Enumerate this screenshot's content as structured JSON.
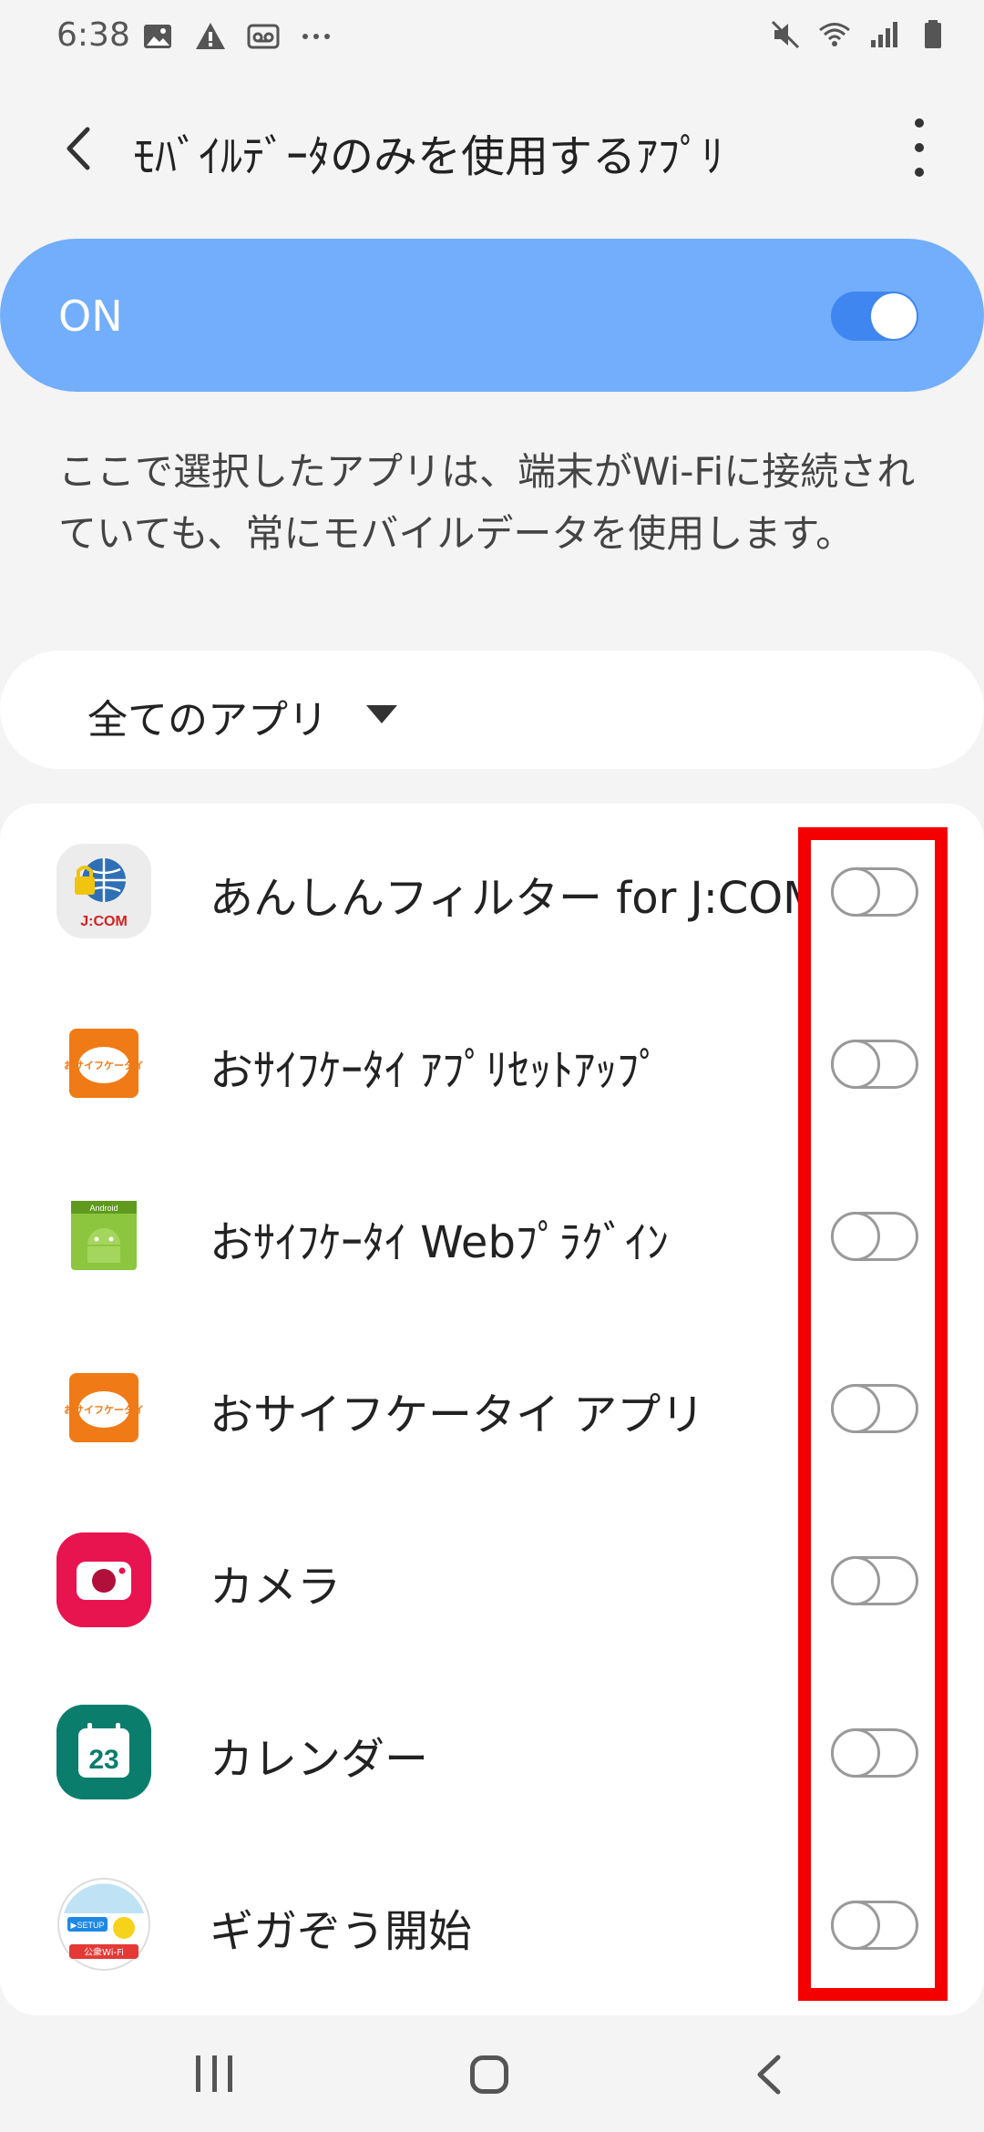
{
  "status_bar": {
    "time": "6:38",
    "left_icons": [
      "image-icon",
      "warning-icon",
      "voicemail-icon",
      "more-dots-icon"
    ],
    "right_icons": [
      "mute-icon",
      "wifi-icon",
      "signal-icon",
      "battery-icon"
    ]
  },
  "header": {
    "title": "ﾓﾊﾞｲﾙﾃﾞｰﾀのみを使用するｱﾌﾟﾘ"
  },
  "master_switch": {
    "label": "ON",
    "state": "on"
  },
  "description": "ここで選択したアプリは、端末がWi-Fiに接続されていても、常にモバイルデータを使用します。",
  "filter": {
    "label": "全てのアプリ"
  },
  "apps": [
    {
      "name": "あんしんフィルター for J:COM",
      "icon": "jcom-filter-icon",
      "enabled": false
    },
    {
      "name": "おｻｲﾌｹｰﾀｲ ｱﾌﾟﾘｾｯﾄｱｯﾌﾟ",
      "icon": "osaifu-keitai-icon",
      "enabled": false
    },
    {
      "name": "おｻｲﾌｹｰﾀｲ Webﾌﾟﾗｸﾞｲﾝ",
      "icon": "android-plugin-icon",
      "enabled": false
    },
    {
      "name": "おサイフケータイ アプリ",
      "icon": "osaifu-keitai-icon",
      "enabled": false
    },
    {
      "name": "カメラ",
      "icon": "camera-icon",
      "enabled": false
    },
    {
      "name": "カレンダー",
      "icon": "calendar-icon",
      "enabled": false
    },
    {
      "name": "ギガぞう開始",
      "icon": "gigazou-icon",
      "enabled": false
    }
  ],
  "icon_text": {
    "jcom": "J:COM",
    "osaifu": "おサイフケータイ",
    "android": "Android",
    "calendar_day": "23",
    "gigazou_setup": "▶SETUP",
    "gigazou_wifi": "公衆Wi-Fi"
  },
  "colors": {
    "accent": "#3f86f1",
    "master_bg": "#72aefc",
    "highlight": "#f40000"
  }
}
